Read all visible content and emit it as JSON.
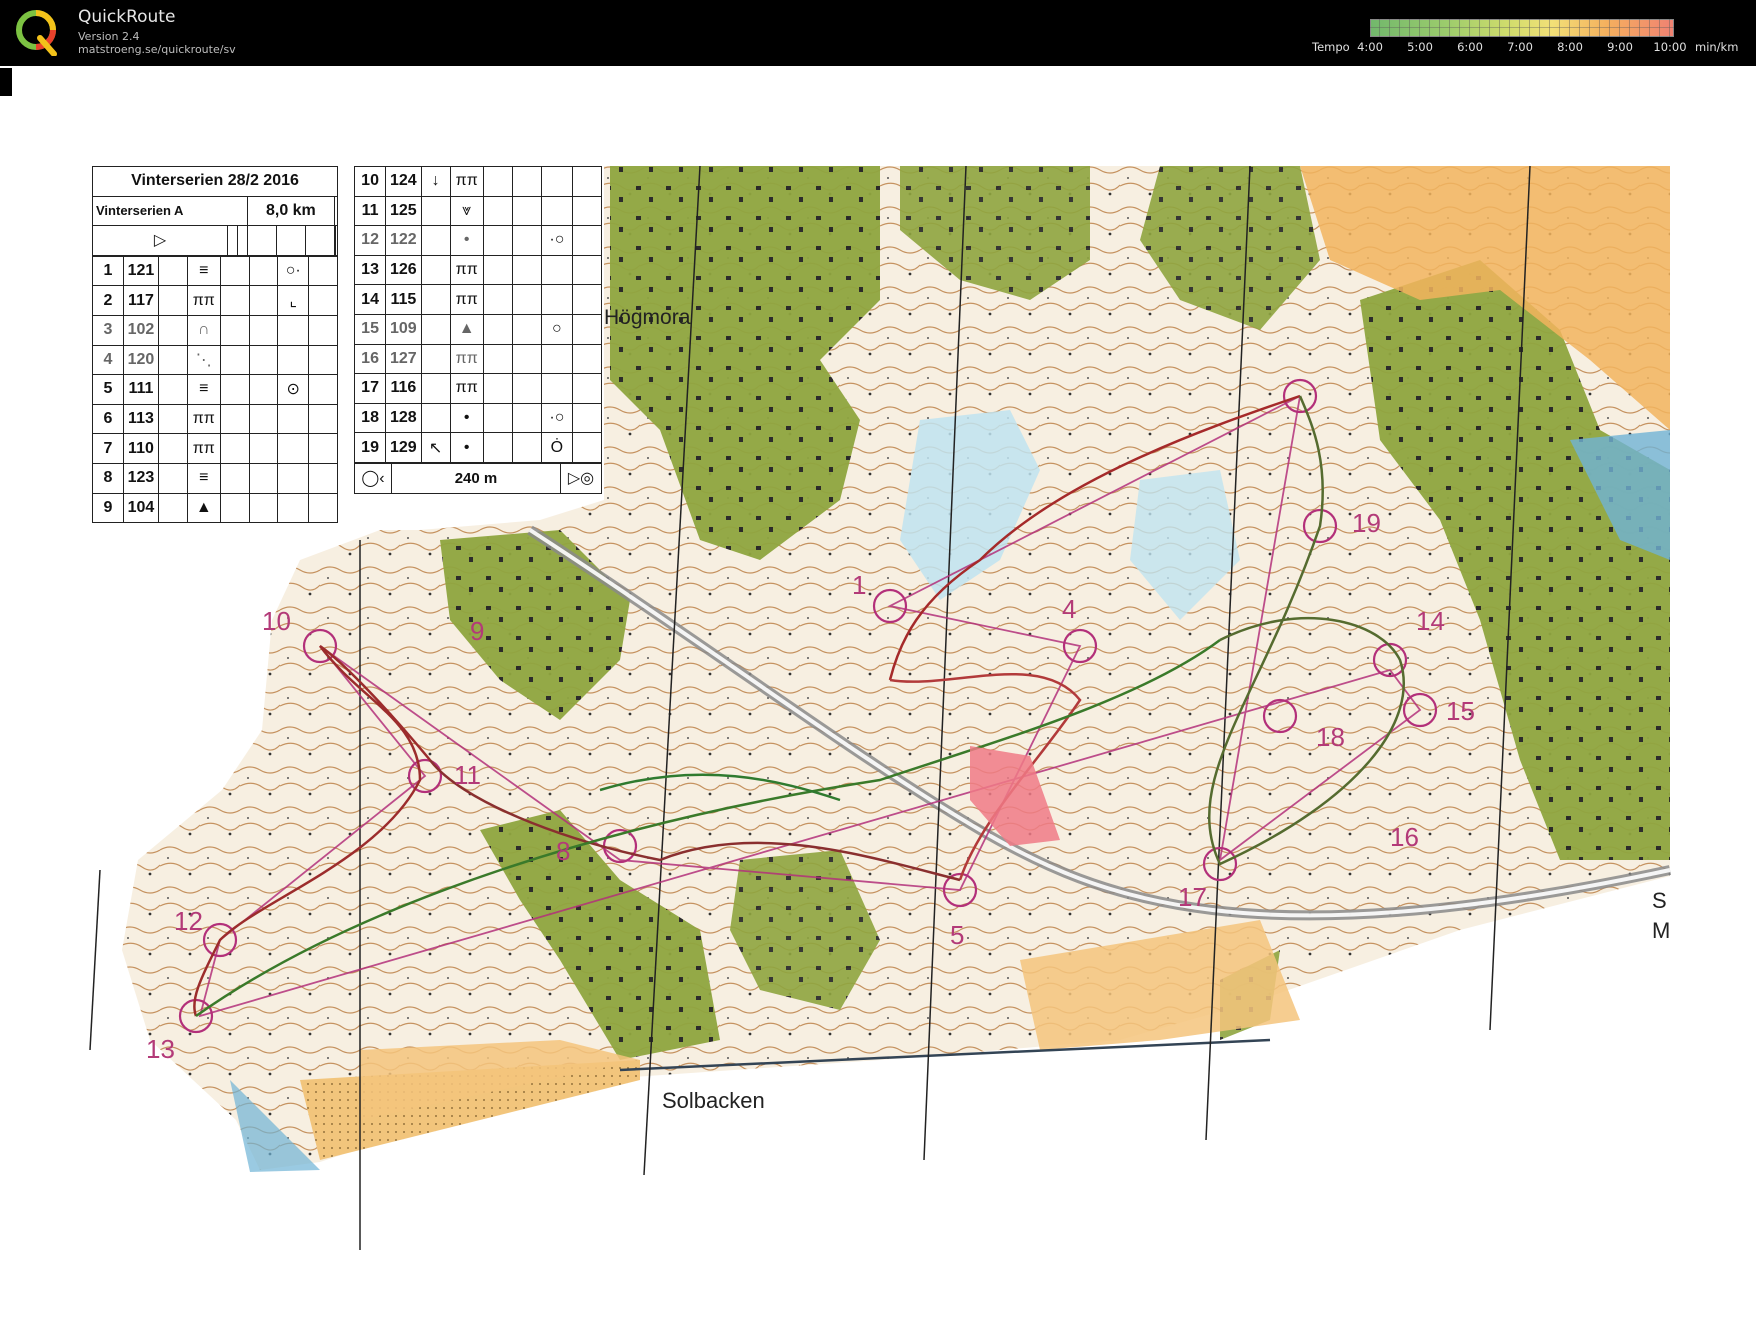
{
  "app": {
    "title": "QuickRoute",
    "version": "Version 2.4",
    "url": "matstroeng.se/quickroute/sv"
  },
  "tempo_legend": {
    "label": "Tempo",
    "ticks": [
      "4:00",
      "5:00",
      "6:00",
      "7:00",
      "8:00",
      "9:00",
      "10:00"
    ],
    "unit": "min/km",
    "colors": [
      "#72b86c",
      "#9ccc6c",
      "#cfdc6c",
      "#f2e077",
      "#f5b05e",
      "#f08272"
    ]
  },
  "description_sheet": {
    "title": "Vinterserien 28/2 2016",
    "class": "Vinterserien A",
    "length": "8,0 km",
    "controls_left": [
      {
        "num": "1",
        "code": "121",
        "symbol": "≡",
        "extra": "○·"
      },
      {
        "num": "2",
        "code": "117",
        "symbol": "ππ",
        "extra": "⌞"
      },
      {
        "num": "3",
        "code": "102",
        "symbol": "∩",
        "extra": ""
      },
      {
        "num": "4",
        "code": "120",
        "symbol": "⋱",
        "extra": ""
      },
      {
        "num": "5",
        "code": "111",
        "symbol": "≡",
        "extra": "⊙"
      },
      {
        "num": "6",
        "code": "113",
        "symbol": "ππ",
        "extra": ""
      },
      {
        "num": "7",
        "code": "110",
        "symbol": "ππ",
        "extra": ""
      },
      {
        "num": "8",
        "code": "123",
        "symbol": "≡",
        "extra": ""
      },
      {
        "num": "9",
        "code": "104",
        "symbol": "▲",
        "extra": ""
      }
    ],
    "controls_right": [
      {
        "num": "10",
        "code": "124",
        "dir": "↓",
        "symbol": "ππ",
        "extra": ""
      },
      {
        "num": "11",
        "code": "125",
        "dir": "",
        "symbol": "⩔",
        "extra": ""
      },
      {
        "num": "12",
        "code": "122",
        "dir": "",
        "symbol": "•",
        "extra": "·○"
      },
      {
        "num": "13",
        "code": "126",
        "dir": "",
        "symbol": "ππ",
        "extra": ""
      },
      {
        "num": "14",
        "code": "115",
        "dir": "",
        "symbol": "ππ",
        "extra": ""
      },
      {
        "num": "15",
        "code": "109",
        "dir": "",
        "symbol": "▲",
        "extra": "○"
      },
      {
        "num": "16",
        "code": "127",
        "dir": "",
        "symbol": "ππ",
        "extra": ""
      },
      {
        "num": "17",
        "code": "116",
        "dir": "",
        "symbol": "ππ",
        "extra": ""
      },
      {
        "num": "18",
        "code": "128",
        "dir": "",
        "symbol": "•",
        "extra": "·○"
      },
      {
        "num": "19",
        "code": "129",
        "dir": "↖",
        "symbol": "•",
        "extra": "Ȯ"
      }
    ],
    "finish_distance": "240 m"
  },
  "map_labels": {
    "hogmora": "Högmora",
    "solbacken": "Solbacken",
    "edge_s": "S",
    "edge_m": "M"
  },
  "control_numbers": [
    "1",
    "4",
    "5",
    "8",
    "9",
    "10",
    "11",
    "12",
    "13",
    "14",
    "15",
    "16",
    "17",
    "18",
    "19"
  ]
}
